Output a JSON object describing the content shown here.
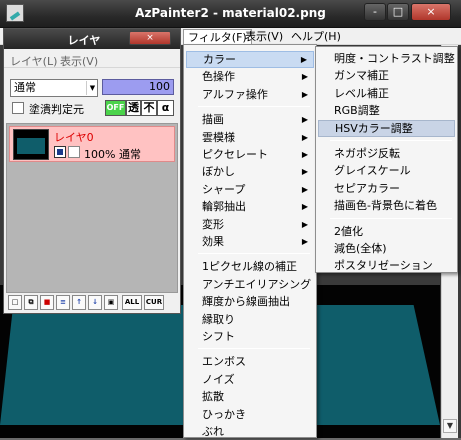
{
  "window": {
    "title": "AzPainter2 - material02.png",
    "min": "-",
    "max": "□",
    "close": "×"
  },
  "menubar": {
    "filter": "フィルタ(F)",
    "view": "表示(V)",
    "help": "ヘルプ(H)"
  },
  "layer_panel": {
    "title": "レイヤ",
    "close": "×",
    "menu_layer": "レイヤ(L)",
    "menu_view": "表示(V)",
    "blend_mode": "通常",
    "opacity": "100",
    "fill_check_label": "塗潰判定元",
    "btn_off": "OFF",
    "btn_trans": "透",
    "btn_mask": "不",
    "btn_alpha": "α",
    "layer": {
      "name": "レイヤ0",
      "info": "100% 通常"
    },
    "toolbar": [
      "new-layer",
      "copy-layer",
      "delete-layer",
      "merge-layer",
      "move-up",
      "move-down",
      "layer-props",
      "ALL",
      "CUR"
    ]
  },
  "filter_menu": {
    "items": [
      {
        "label": "カラー",
        "sub": true
      },
      {
        "label": "色操作",
        "sub": true
      },
      {
        "label": "アルファ操作",
        "sub": true
      },
      {
        "sep": true
      },
      {
        "label": "描画",
        "sub": true
      },
      {
        "label": "雲模様",
        "sub": true
      },
      {
        "label": "ピクセレート",
        "sub": true
      },
      {
        "label": "ぼかし",
        "sub": true
      },
      {
        "label": "シャープ",
        "sub": true
      },
      {
        "label": "輪郭抽出",
        "sub": true
      },
      {
        "label": "変形",
        "sub": true
      },
      {
        "label": "効果",
        "sub": true
      },
      {
        "sep": true
      },
      {
        "label": "1ピクセル線の補正"
      },
      {
        "label": "アンチエイリアシング"
      },
      {
        "label": "輝度から線画抽出"
      },
      {
        "label": "縁取り"
      },
      {
        "label": "シフト"
      },
      {
        "sep": true
      },
      {
        "label": "エンボス"
      },
      {
        "label": "ノイズ"
      },
      {
        "label": "拡散"
      },
      {
        "label": "ひっかき"
      },
      {
        "label": "ぶれ"
      }
    ]
  },
  "color_submenu": {
    "items": [
      {
        "label": "明度・コントラスト調整"
      },
      {
        "label": "ガンマ補正"
      },
      {
        "label": "レベル補正"
      },
      {
        "label": "RGB調整"
      },
      {
        "label": "HSVカラー調整"
      },
      {
        "sep": true
      },
      {
        "label": "ネガポジ反転"
      },
      {
        "label": "グレイスケール"
      },
      {
        "label": "セピアカラー"
      },
      {
        "label": "描画色-背景色に着色"
      },
      {
        "sep": true
      },
      {
        "label": "2値化"
      },
      {
        "label": "減色(全体)"
      },
      {
        "label": "ポスタリゼーション"
      }
    ]
  }
}
